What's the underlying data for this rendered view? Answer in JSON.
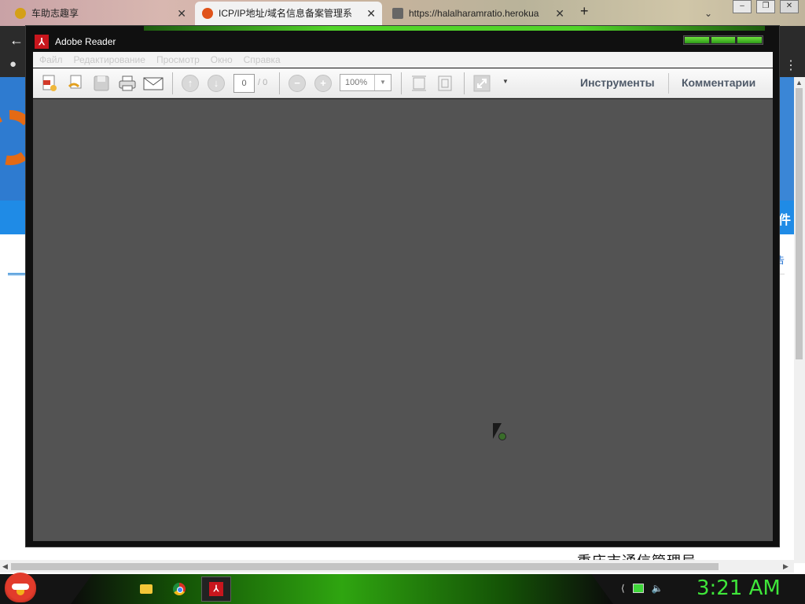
{
  "browser": {
    "tabs": [
      {
        "title": "车助志趣享"
      },
      {
        "title": "ICP/IP地址/域名信息备案管理系"
      },
      {
        "title": "https://halalharamratio.herokua"
      }
    ],
    "new_tab": "+",
    "footer_text": "重庆市通信管理局",
    "side_text": "告",
    "nav_char": "件"
  },
  "reader": {
    "title": "Adobe Reader",
    "menu": [
      "Файл",
      "Редактирование",
      "Просмотр",
      "Окно",
      "Справка"
    ],
    "page_current": "0",
    "page_total": "/ 0",
    "zoom": "100%",
    "tools_label": "Инструменты",
    "comments_label": "Комментарии"
  },
  "taskbar": {
    "clock": "3:21 AM"
  }
}
